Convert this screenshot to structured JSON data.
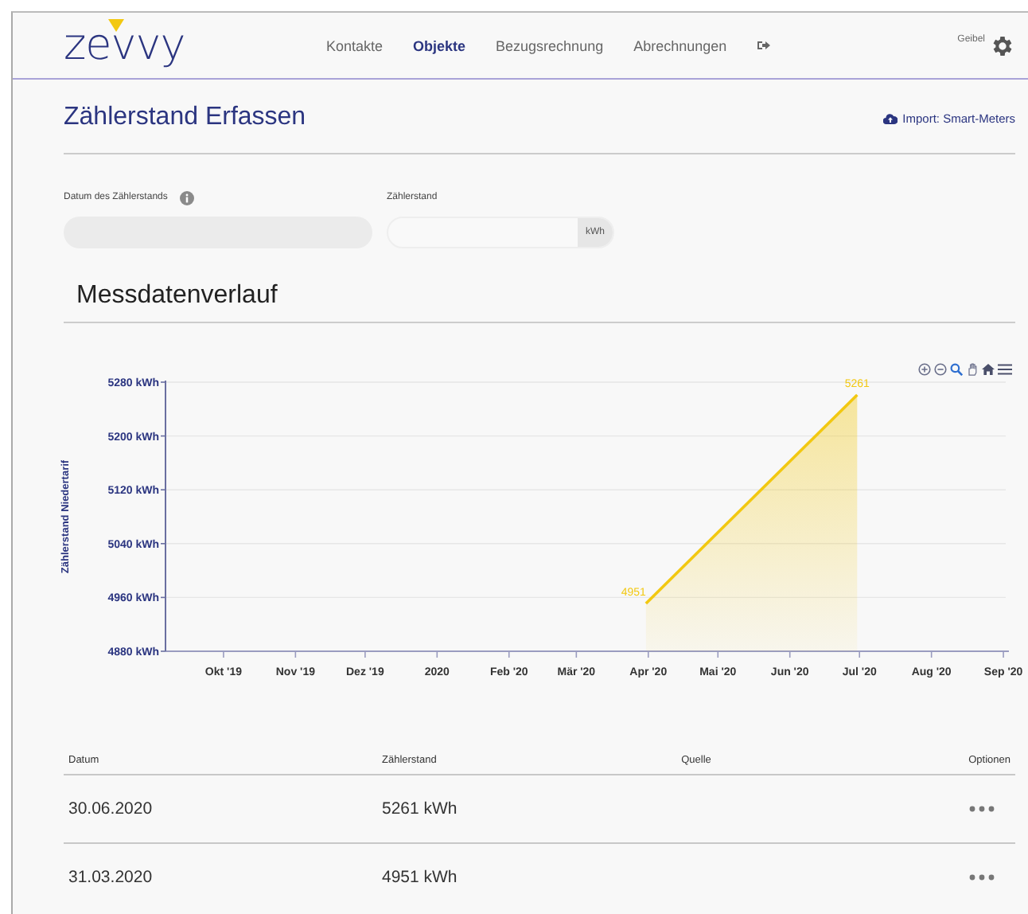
{
  "header": {
    "logo": "zevvy",
    "nav": [
      {
        "label": "Kontakte",
        "selected": false
      },
      {
        "label": "Objekte",
        "selected": true
      },
      {
        "label": "Bezugsrechnung",
        "selected": false
      },
      {
        "label": "Abrechnungen",
        "selected": false
      }
    ],
    "user": "Geibel"
  },
  "page_title": "Zählerstand Erfassen",
  "import_link": "Import: Smart-Meters",
  "form": {
    "date_label": "Datum des Zählerstands",
    "meter_label": "Zählerstand",
    "meter_unit": "kWh"
  },
  "chart": {
    "title": "Messdatenverlauf",
    "chart_data": {
      "type": "area",
      "ylabel": "Zählerstand Niedertarif",
      "x": [
        "2020-03-31",
        "2020-06-30"
      ],
      "series": [
        {
          "color": "#f2c811",
          "values": [
            4951,
            5261
          ]
        }
      ],
      "xlim": [
        "2019-09-06",
        "2020-09-02"
      ],
      "ylim": [
        4880,
        5280
      ],
      "xticks": [
        {
          "value": "2019-10-01",
          "label": "Okt '19"
        },
        {
          "value": "2019-11-01",
          "label": "Nov '19"
        },
        {
          "value": "2019-12-01",
          "label": "Dez '19"
        },
        {
          "value": "2020-01-01",
          "label": "2020"
        },
        {
          "value": "2020-02-01",
          "label": "Feb '20"
        },
        {
          "value": "2020-03-01",
          "label": "Mär '20"
        },
        {
          "value": "2020-04-01",
          "label": "Apr '20"
        },
        {
          "value": "2020-05-01",
          "label": "Mai '20"
        },
        {
          "value": "2020-06-01",
          "label": "Jun '20"
        },
        {
          "value": "2020-07-01",
          "label": "Jul '20"
        },
        {
          "value": "2020-08-01",
          "label": "Aug '20"
        },
        {
          "value": "2020-09-01",
          "label": "Sep '20"
        }
      ],
      "yticks": [
        {
          "value": 4880,
          "label": "4880 kWh"
        },
        {
          "value": 4960,
          "label": "4960 kWh"
        },
        {
          "value": 5040,
          "label": "5040 kWh"
        },
        {
          "value": 5120,
          "label": "5120 kWh"
        },
        {
          "value": 5200,
          "label": "5200 kWh"
        },
        {
          "value": 5280,
          "label": "5280 kWh"
        }
      ],
      "data_labels": true,
      "grid": true
    }
  },
  "table": {
    "columns": [
      "Datum",
      "Zählerstand",
      "Quelle",
      "Optionen"
    ],
    "rows": [
      {
        "date": "30.06.2020",
        "reading": "5261 kWh"
      },
      {
        "date": "31.03.2020",
        "reading": "4951 kWh"
      }
    ]
  }
}
